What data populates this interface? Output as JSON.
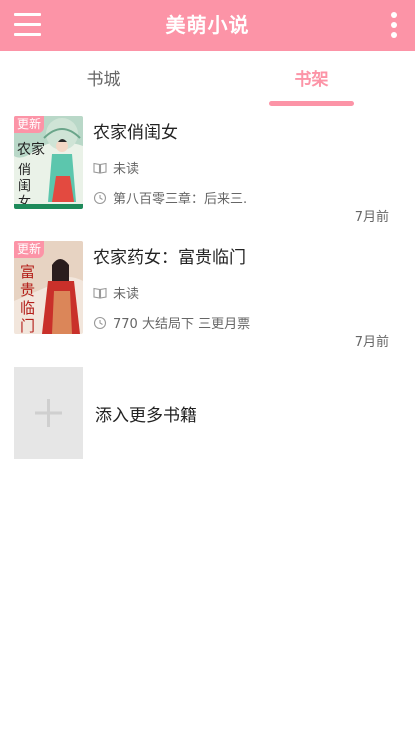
{
  "app": {
    "title": "美萌小说",
    "accent": "#fc94a7"
  },
  "tabs": [
    {
      "label": "书城",
      "active": false
    },
    {
      "label": "书架",
      "active": true
    }
  ],
  "books": [
    {
      "title": "农家俏闺女",
      "badge": "更新",
      "status": "未读",
      "chapter": "第八百零三章：后来三.",
      "time": "7月前"
    },
    {
      "title": "农家药女：富贵临门",
      "badge": "更新",
      "status": "未读",
      "chapter": "770 大结局下  三更月票",
      "time": "7月前"
    }
  ],
  "add_more": {
    "label": "添入更多书籍"
  }
}
